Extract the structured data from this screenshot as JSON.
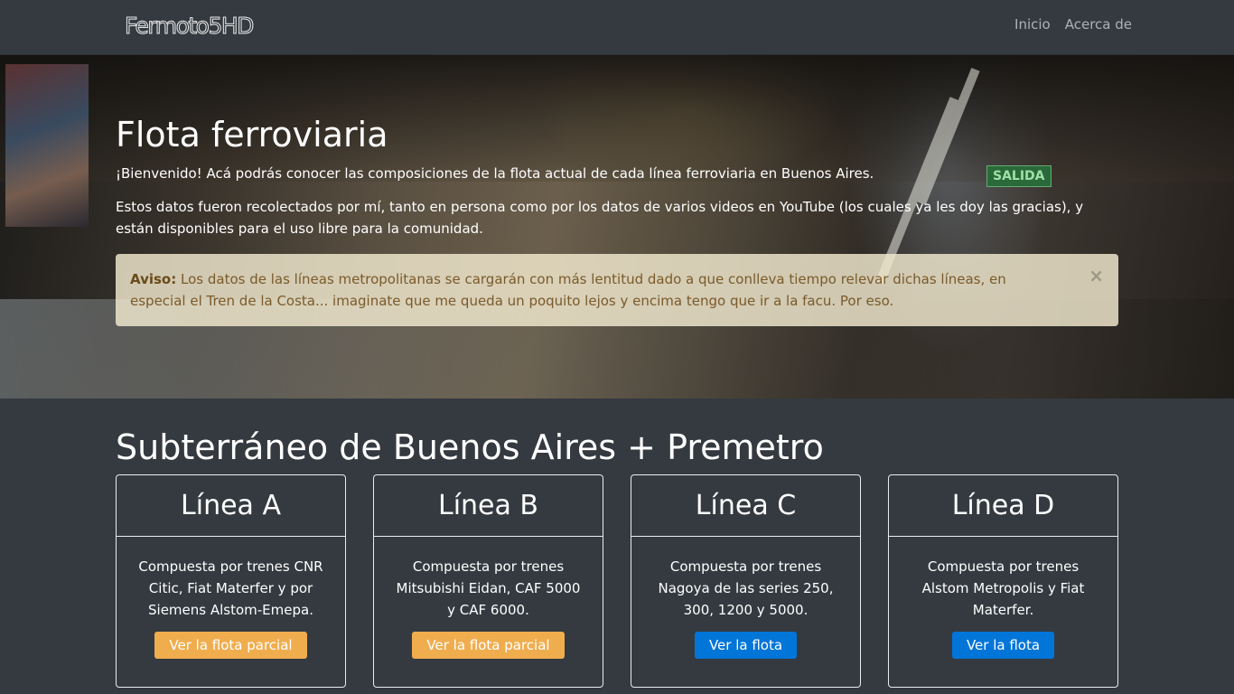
{
  "navbar": {
    "brand": "Fermoto5HD",
    "links": [
      "Inicio",
      "Acerca de"
    ]
  },
  "hero": {
    "title": "Flota ferroviaria",
    "lead": "¡Bienvenido! Acá podrás conocer las composiciones de la flota actual de cada línea ferroviaria en Buenos Aires.",
    "text": "Estos datos fueron recolectados por mí, tanto en persona como por los datos de varios videos en YouTube (los cuales ya les doy las gracias), y están disponibles para el uso libre para la comunidad.",
    "alert_label": "Aviso:",
    "alert_text": "Los datos de las líneas metropolitanas se cargarán con más lentitud dado a que conlleva tiempo relevar dichas líneas, en especial el Tren de la Costa... imaginate que me queda un poquito lejos y encima tengo que ir a la facu. Por eso.",
    "alert_close": "×",
    "exit_sign": "SALIDA"
  },
  "section": {
    "title": "Subterráneo de Buenos Aires + Premetro"
  },
  "cards": [
    {
      "title": "Línea A",
      "text": "Compuesta por trenes CNR Citic, Fiat Materfer y por Siemens Alstom-Emepa.",
      "button": "Ver la flota parcial",
      "button_style": "warning"
    },
    {
      "title": "Línea B",
      "text": "Compuesta por trenes Mitsubishi Eidan, CAF 5000 y CAF 6000.",
      "button": "Ver la flota parcial",
      "button_style": "warning"
    },
    {
      "title": "Línea C",
      "text": "Compuesta por trenes Nagoya de las series 250, 300, 1200 y 5000.",
      "button": "Ver la flota",
      "button_style": "primary"
    },
    {
      "title": "Línea D",
      "text": "Compuesta por trenes Alstom Metropolis y Fiat Materfer.",
      "button": "Ver la flota",
      "button_style": "primary"
    }
  ],
  "colors": {
    "background": "#343a40",
    "warning": "#f0ad4e",
    "primary": "#0275d8",
    "alert_bg": "#f3eacf"
  }
}
